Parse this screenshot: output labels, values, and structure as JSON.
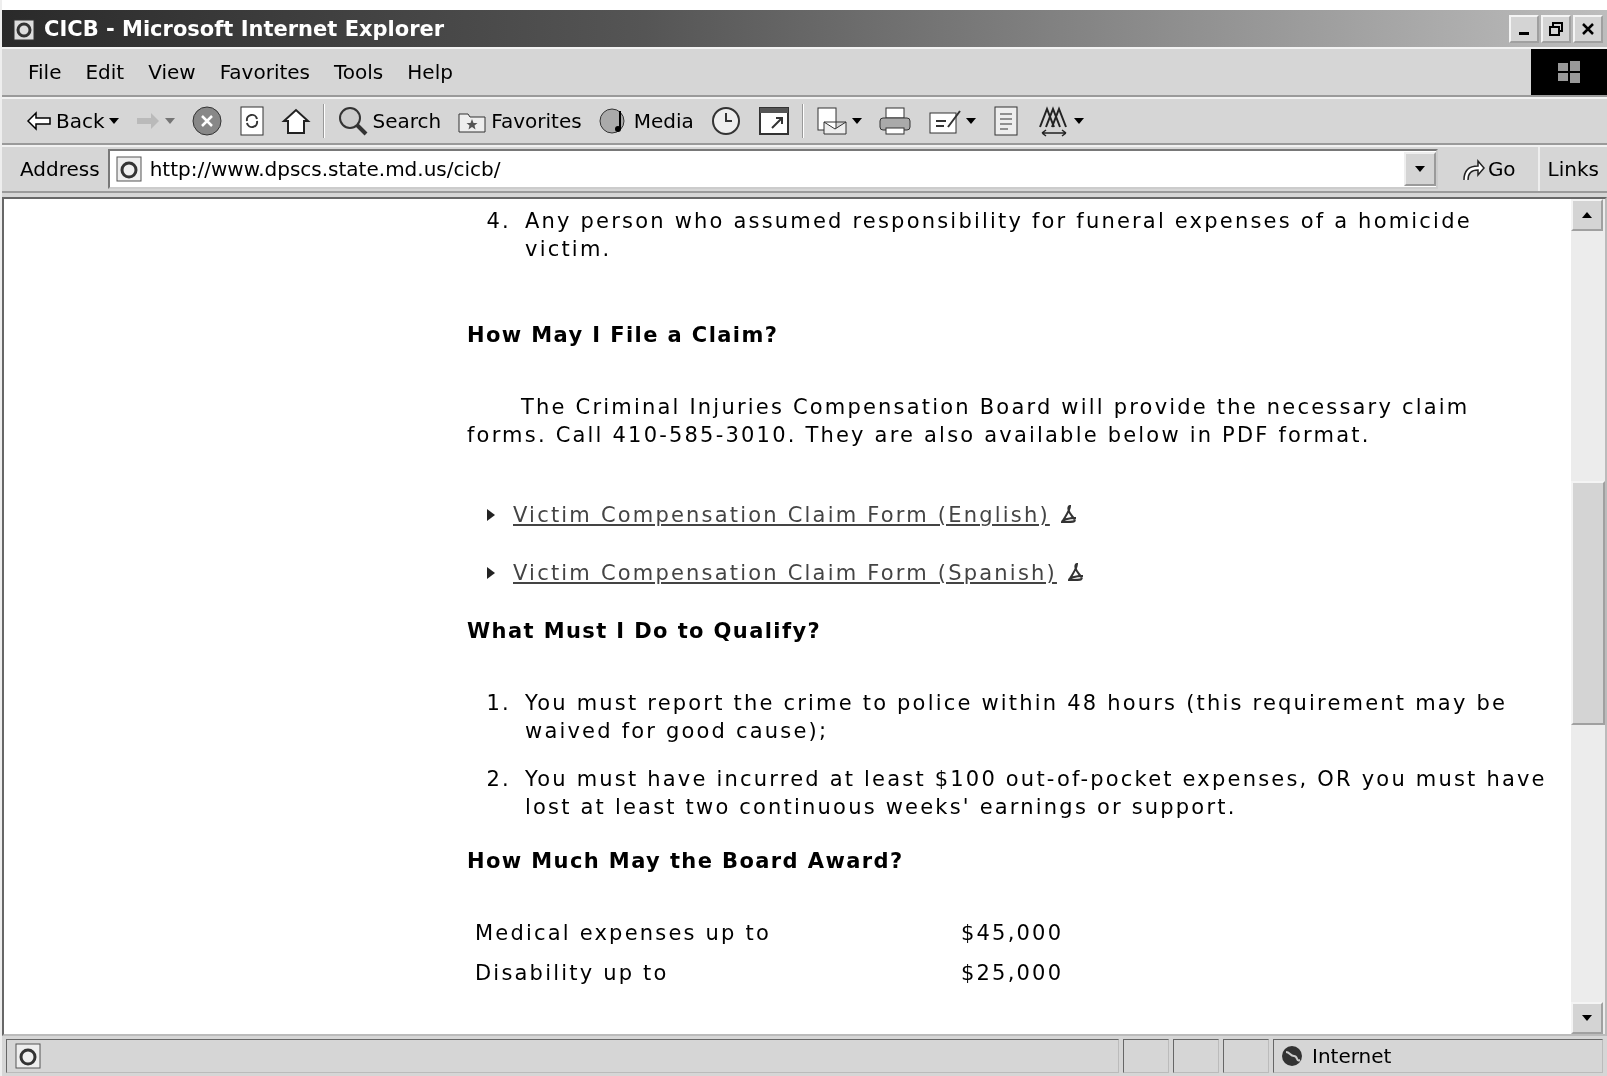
{
  "window": {
    "title": "CICB - Microsoft Internet Explorer"
  },
  "menu": [
    "File",
    "Edit",
    "View",
    "Favorites",
    "Tools",
    "Help"
  ],
  "toolbar": [
    {
      "kind": "back",
      "label": "Back",
      "dropdown": true,
      "disabled": false
    },
    {
      "kind": "forward",
      "dropdown": true,
      "disabled": true
    },
    {
      "kind": "stop",
      "dropdown": false,
      "disabled": false
    },
    {
      "kind": "refresh",
      "dropdown": false,
      "disabled": false
    },
    {
      "kind": "home",
      "dropdown": false,
      "disabled": false
    },
    {
      "kind": "separator"
    },
    {
      "kind": "search",
      "label": "Search",
      "dropdown": false,
      "disabled": false
    },
    {
      "kind": "favorites",
      "label": "Favorites",
      "dropdown": false,
      "disabled": false
    },
    {
      "kind": "media",
      "label": "Media",
      "dropdown": false,
      "disabled": false
    },
    {
      "kind": "history",
      "dropdown": false,
      "disabled": false
    },
    {
      "kind": "window",
      "dropdown": false,
      "disabled": false
    },
    {
      "kind": "separator"
    },
    {
      "kind": "mail",
      "dropdown": true,
      "disabled": false
    },
    {
      "kind": "print",
      "dropdown": false,
      "disabled": false
    },
    {
      "kind": "edit",
      "dropdown": true,
      "disabled": false
    },
    {
      "kind": "page",
      "dropdown": false,
      "disabled": false
    },
    {
      "kind": "font",
      "dropdown": true,
      "disabled": false
    }
  ],
  "address": {
    "label": "Address",
    "value": "http://www.dpscs.state.md.us/cicb/",
    "go": "Go",
    "links": "Links"
  },
  "content": [
    {
      "kind": "list_item",
      "number": "4.",
      "text": "Any person who assumed responsibility for funeral expenses of a homicide victim."
    },
    {
      "kind": "heading",
      "text": "How May I File a Claim?"
    },
    {
      "kind": "paragraph",
      "text": "The Criminal Injuries Compensation Board will provide the necessary claim forms. Call 410-585-3010. They are also available below in PDF format."
    },
    {
      "kind": "links",
      "items": [
        "Victim Compensation Claim Form (English)",
        "Victim Compensation Claim Form (Spanish)"
      ]
    },
    {
      "kind": "heading",
      "text": "What Must I Do to Qualify?"
    },
    {
      "kind": "list_item",
      "number": "1.",
      "text": "You must report the crime to police within 48 hours (this requirement may be waived for good cause);"
    },
    {
      "kind": "list_item",
      "number": "2.",
      "text": "You must have incurred at least $100 out-of-pocket expenses, OR you must have lost at least two continuous weeks' earnings or support."
    },
    {
      "kind": "heading",
      "text": "How Much May the Board Award?"
    },
    {
      "kind": "table",
      "rows": [
        [
          "Medical expenses up to",
          "$45,000"
        ],
        [
          "Disability up to",
          "$25,000"
        ]
      ]
    }
  ],
  "status_bar": {
    "zone": "Internet"
  }
}
